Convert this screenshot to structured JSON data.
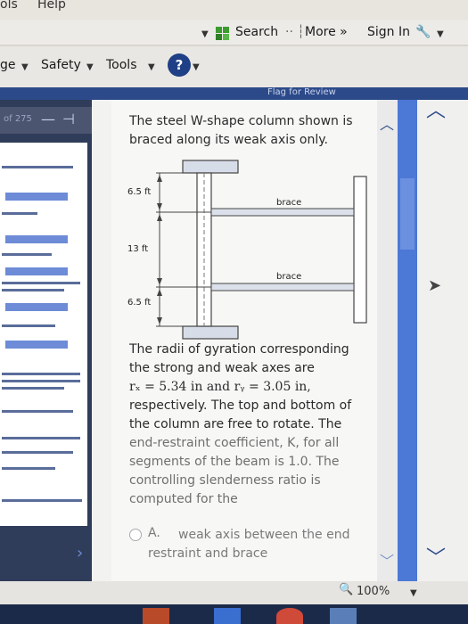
{
  "menubar": {
    "tools": "ols",
    "help": "Help"
  },
  "toolbar": {
    "search": "Search",
    "more": "More »",
    "signin": "Sign In"
  },
  "commandbar": {
    "page": "ge",
    "safety": "Safety",
    "tools": "Tools"
  },
  "app": {
    "flag": "Flag for Review",
    "counter": "of 275"
  },
  "question": {
    "intro_line1": "The steel W-shape column shown is",
    "intro_line2": "braced along its weak axis only.",
    "body_lines": [
      "The radii of gyration corresponding",
      "the strong and weak axes are",
      "respectively. The top and bottom of",
      "the column are free to rotate. The",
      "end-restraint coefficient, K, for all",
      "segments of the beam is 1.0. The",
      "controlling slenderness ratio is",
      "computed for the"
    ],
    "rx_line": "rₓ = 5.34 in and rᵧ = 3.05 in,",
    "option_letter": "A.",
    "option_line1": "weak axis between the end",
    "option_line2": "restraint and brace"
  },
  "diagram": {
    "top_dim": "6.5 ft",
    "mid_dim": "13 ft",
    "bot_dim": "6.5 ft",
    "brace1": "brace",
    "brace2": "brace"
  },
  "status": {
    "zoom": "100%"
  },
  "colors": {
    "accent": "#4c78d6",
    "panel": "#2f3d5a",
    "header": "#2c4a8a"
  }
}
